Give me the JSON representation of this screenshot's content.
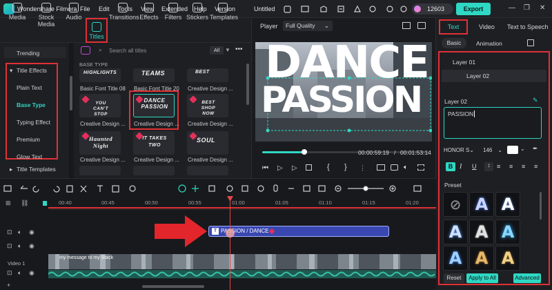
{
  "app": {
    "title": "Wondershare Filmora",
    "menu": [
      "File",
      "Edit",
      "Tools",
      "View",
      "Extended",
      "Help",
      "Version"
    ],
    "project": "Untitled",
    "credits": "12603",
    "export_label": "Export"
  },
  "tabs": [
    "Media",
    "Stock Media",
    "Audio",
    "Titles",
    "Transitions",
    "Effects",
    "Filters",
    "Stickers",
    "Templates"
  ],
  "sidebar": {
    "items": [
      "Trending",
      "Title Effects",
      "Plain Text",
      "Base Type",
      "Typing Effect",
      "Premium",
      "Glow Text",
      "Title Templates"
    ]
  },
  "media": {
    "search_placeholder": "Search all titles",
    "filter": "All",
    "section": "BASE TYPE",
    "cards": [
      {
        "thumb": "HIGHLIGHTS",
        "caption": "Basic Font Title 08"
      },
      {
        "thumb": "TEAMS",
        "caption": "Basic Font Title 20"
      },
      {
        "thumb": "BEST",
        "caption": "Creative Design ..."
      },
      {
        "thumb": "YOU CAN'T STOP",
        "caption": "Creative Design ..."
      },
      {
        "thumb": "DANCE PASSION",
        "caption": "Creative Design ..."
      },
      {
        "thumb": "BEST SHOP NOW",
        "caption": "Creative Design ..."
      },
      {
        "thumb": "Haunted Night",
        "caption": "Creative Design ..."
      },
      {
        "thumb": "IT TAKES TWO",
        "caption": "Creative Design ..."
      },
      {
        "thumb": "SOUL",
        "caption": "Creative Design ..."
      },
      {
        "thumb": "",
        "caption": ""
      },
      {
        "thumb": "",
        "caption": ""
      },
      {
        "thumb": "",
        "caption": ""
      }
    ]
  },
  "player": {
    "label": "Player",
    "quality": "Full Quality",
    "overlay_line1": "DANCE",
    "overlay_line2": "PASSION",
    "current_time": "00:00:59:19",
    "separator": "/",
    "total_time": "00:01:53:14",
    "progress": 0.25
  },
  "right": {
    "tabs": [
      "Text",
      "Video",
      "Text to Speech"
    ],
    "subtabs": [
      "Basic",
      "Animation"
    ],
    "layers": [
      "Layer 01",
      "Layer 02"
    ],
    "layer_label": "Layer 02",
    "text_value": "PASSION",
    "font": "HONOR S",
    "font_size": "146",
    "preset_label": "Preset",
    "reset": "Reset",
    "apply_all": "Apply to All",
    "advanced": "Advanced",
    "accent": "#2fd8c4"
  },
  "timeline": {
    "ticks": [
      "00:40",
      "00:45",
      "00:50",
      "00:55",
      "01:00",
      "01:05",
      "01:10",
      "01:15",
      "01:20"
    ],
    "clip_label": "PASSION / DANCE",
    "video_track": "Video 1",
    "video_clip": "my message to my Stack"
  }
}
